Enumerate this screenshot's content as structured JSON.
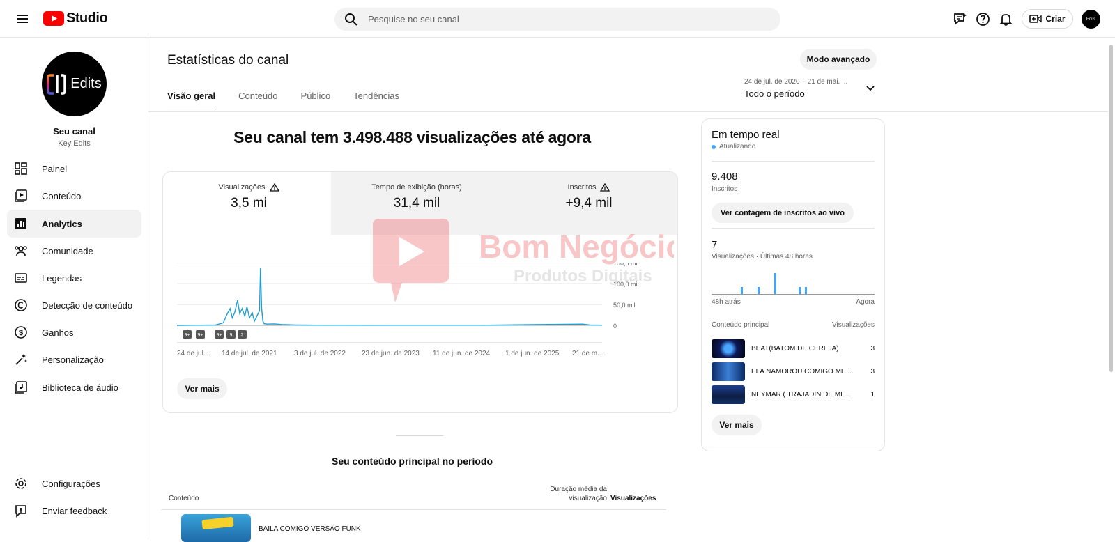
{
  "topbar": {
    "logo_text": "Studio",
    "search_placeholder": "Pesquise no seu canal",
    "create_label": "Criar",
    "avatar_label": "Edits"
  },
  "sidebar": {
    "channel_name": "Seu canal",
    "channel_handle": "Key Edits",
    "avatar_text": "Edits",
    "items": [
      {
        "label": "Painel",
        "icon": "dashboard-icon"
      },
      {
        "label": "Conteúdo",
        "icon": "content-icon"
      },
      {
        "label": "Analytics",
        "icon": "analytics-icon",
        "active": true
      },
      {
        "label": "Comunidade",
        "icon": "community-icon"
      },
      {
        "label": "Legendas",
        "icon": "subtitles-icon"
      },
      {
        "label": "Detecção de conteúdo",
        "icon": "copyright-icon"
      },
      {
        "label": "Ganhos",
        "icon": "earn-icon"
      },
      {
        "label": "Personalização",
        "icon": "customization-icon"
      },
      {
        "label": "Biblioteca de áudio",
        "icon": "audio-library-icon"
      }
    ],
    "bottom": [
      {
        "label": "Configurações",
        "icon": "settings-icon"
      },
      {
        "label": "Enviar feedback",
        "icon": "feedback-icon"
      }
    ]
  },
  "main": {
    "title": "Estatísticas do canal",
    "advanced_label": "Modo avançado",
    "tabs": [
      "Visão geral",
      "Conteúdo",
      "Público",
      "Tendências"
    ],
    "date_range_sub": "24 de jul. de 2020 – 21 de mai. ...",
    "date_range_main": "Todo o período",
    "headline": "Seu canal tem 3.498.488 visualizações até agora",
    "metrics": [
      {
        "label": "Visualizações",
        "value": "3,5 mi",
        "warning": true
      },
      {
        "label": "Tempo de exibição (horas)",
        "value": "31,4 mil",
        "warning": false
      },
      {
        "label": "Inscritos",
        "value": "+9,4 mil",
        "warning": true
      }
    ],
    "ver_mais": "Ver mais",
    "content_title": "Seu conteúdo principal no período",
    "content_headers": {
      "content": "Conteúdo",
      "duration": "Duração média da visualização",
      "views": "Visualizações"
    },
    "content_rows": [
      {
        "title": "BAILA COMIGO VERSÃO FUNK"
      }
    ]
  },
  "chart_data": {
    "type": "line",
    "x_tick_labels": [
      "24 de jul...",
      "14 de jul. de 2021",
      "3 de jul. de 2022",
      "23 de jun. de 2023",
      "11 de jun. de 2024",
      "1 de jun. de 2025",
      "21 de m..."
    ],
    "y_tick_labels": [
      "150,0 mil",
      "100,0 mil",
      "50,0 mil",
      "0"
    ],
    "ylim": [
      0,
      150000
    ],
    "grid": true,
    "color": "#1f9ed1",
    "series": [
      {
        "x": [
          "2020-07-24",
          "2020-11-01",
          "2021-01-01",
          "2021-02-01",
          "2021-02-15",
          "2021-03-01",
          "2021-03-10",
          "2021-03-20",
          "2021-04-01",
          "2021-04-10",
          "2021-04-20",
          "2021-05-01",
          "2021-05-10",
          "2021-05-20",
          "2021-06-01",
          "2021-06-10",
          "2021-06-20",
          "2021-07-01",
          "2021-07-05",
          "2021-07-10",
          "2021-07-15",
          "2021-07-20",
          "2021-08-01",
          "2021-09-01",
          "2021-10-01",
          "2021-12-01",
          "2022-03-01",
          "2023-01-01",
          "2024-01-01",
          "2025-03-01",
          "2025-04-01",
          "2025-05-21"
        ],
        "y": [
          0,
          500,
          1000,
          6000,
          25000,
          40000,
          18000,
          30000,
          60000,
          28000,
          40000,
          22000,
          45000,
          18000,
          30000,
          10000,
          22000,
          35000,
          138000,
          40000,
          10000,
          4000,
          3000,
          3500,
          2000,
          1000,
          500,
          300,
          300,
          3000,
          1000,
          500
        ]
      }
    ],
    "badges": [
      "9+",
      "9+",
      "9+",
      "9",
      "2"
    ]
  },
  "realtime": {
    "title": "Em tempo real",
    "status": "Atualizando",
    "subs_value": "9.408",
    "subs_label": "Inscritos",
    "subs_button": "Ver contagem de inscritos ao vivo",
    "views_value": "7",
    "views_label": "Visualizações · Últimas 48 horas",
    "axis_left": "48h atrás",
    "axis_right": "Agora",
    "head_content": "Conteúdo principal",
    "head_views": "Visualizações",
    "bar_values": [
      {
        "hour": 3,
        "views": 1
      },
      {
        "hour": 8,
        "views": 1
      },
      {
        "hour": 13,
        "views": 3
      },
      {
        "hour": 20,
        "views": 1
      },
      {
        "hour": 22,
        "views": 1
      }
    ],
    "videos": [
      {
        "title": "BEAT(BATOM DE CEREJA)",
        "views": "3"
      },
      {
        "title": "ELA NAMOROU COMIGO ME ...",
        "views": "3"
      },
      {
        "title": "NEYMAR ( TRAJADIN DE ME...",
        "views": "1"
      }
    ],
    "ver_mais": "Ver mais"
  },
  "watermark": {
    "line1": "Bom Negócio",
    "line2": "Produtos Digitais"
  }
}
